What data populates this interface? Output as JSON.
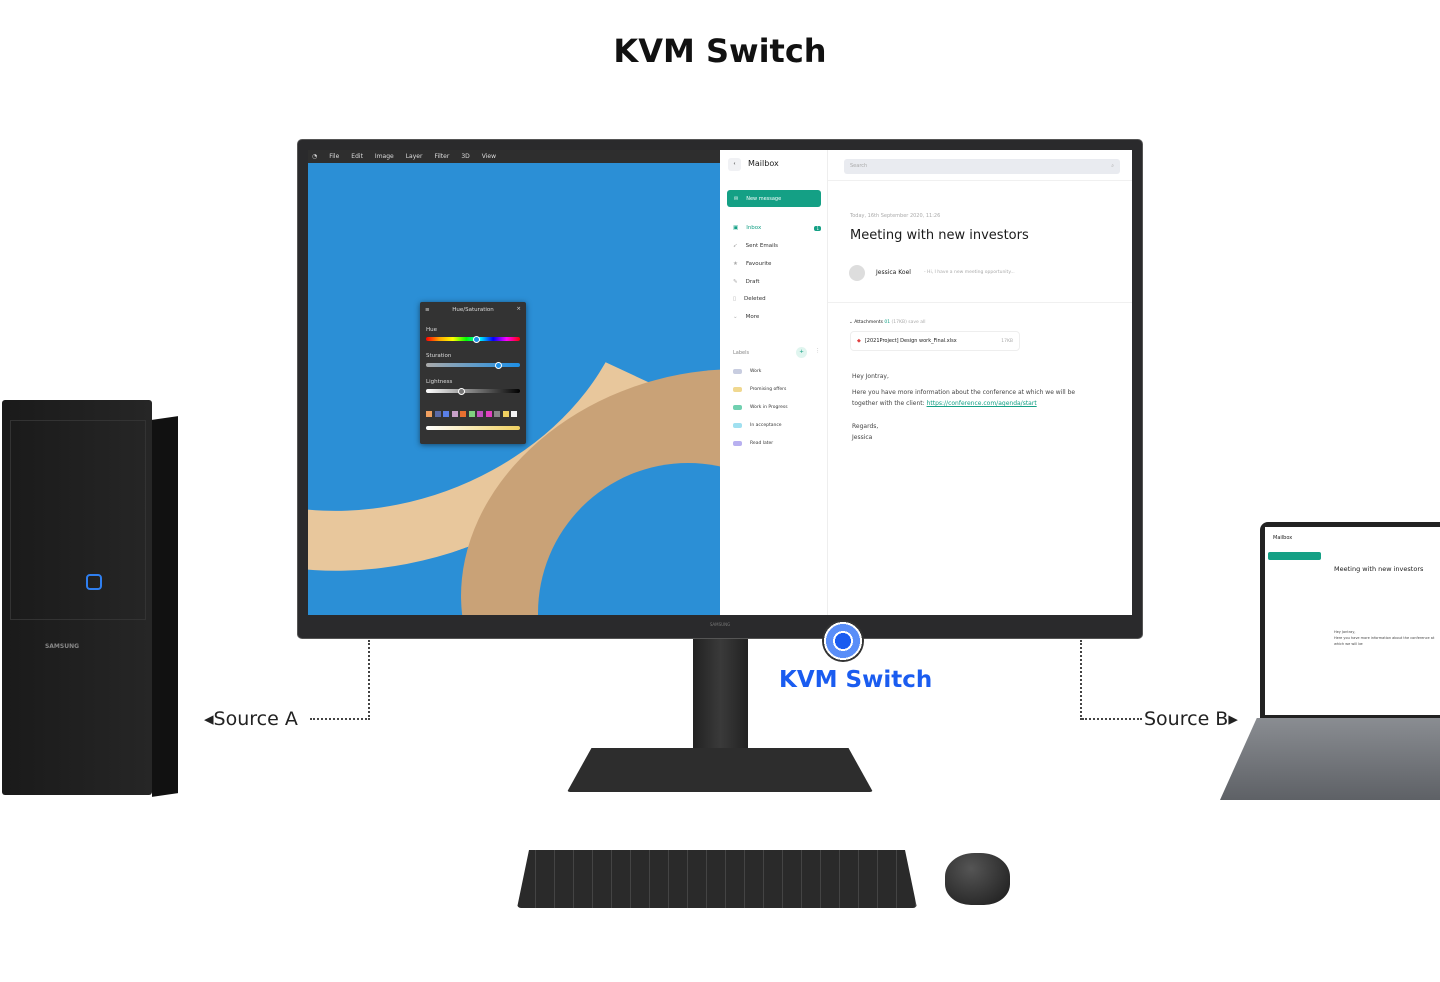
{
  "title": "KVM Switch",
  "kvm_label": "KVM Switch",
  "source_a": "Source A",
  "source_b": "Source B",
  "brand": "SAMSUNG",
  "colors": {
    "accent_blue": "#1a5cf0",
    "mail_green": "#14a085"
  },
  "editor": {
    "menu": [
      "File",
      "Edit",
      "Image",
      "Layer",
      "Filter",
      "3D",
      "View"
    ],
    "panel": {
      "title": "Hue/Saturation",
      "hue_label": "Hue",
      "saturation_label": "Sturation",
      "lightness_label": "Lightness",
      "hue_value": 0.54,
      "saturation_value": 0.77,
      "lightness_value": 0.38,
      "swatches": [
        "#f0a060",
        "#5a6aa8",
        "#5a80e8",
        "#c8a0c8",
        "#e87030",
        "#80d080",
        "#c050c0",
        "#e040c0",
        "#888888",
        "#f0d060",
        "#f4f4f4"
      ]
    }
  },
  "mail": {
    "header": "Mailbox",
    "search_placeholder": "Search",
    "new_message": "New message",
    "nav": [
      {
        "label": "Inbox",
        "icon": "inbox-icon",
        "badge": "1"
      },
      {
        "label": "Sent Emails",
        "icon": "send-icon"
      },
      {
        "label": "Favourite",
        "icon": "star-icon"
      },
      {
        "label": "Draft",
        "icon": "pencil-icon"
      },
      {
        "label": "Deleted",
        "icon": "trash-icon"
      },
      {
        "label": "More",
        "icon": "chevron-down-icon"
      }
    ],
    "labels_title": "Labels",
    "labels": [
      {
        "label": "Work",
        "color": "#c8cde0"
      },
      {
        "label": "Promising offers",
        "color": "#f0d890"
      },
      {
        "label": "Work in Progress",
        "color": "#70d0b0"
      },
      {
        "label": "In acceptance",
        "color": "#a0e0f0"
      },
      {
        "label": "Read later",
        "color": "#b8b0f0"
      }
    ],
    "date": "Today, 16th September 2020, 11:26",
    "subject": "Meeting with new investors",
    "sender": "Jessica Koel",
    "preview": "- Hi, I have a new meeting opportunity...",
    "attachments_label": "Attachments",
    "attachments_count": "01",
    "attachments_size": "(17KB)",
    "save_all": "save all",
    "file_name": "[2021Project] Design work_Final.xlsx",
    "file_size": "17KB",
    "greeting": "Hey Jontray,",
    "body1": "Here you have more information about the conference at which we will be",
    "body2": "together with the client:",
    "link": "https://conference.com/agenda/start",
    "regards": "Regards,",
    "signature": "Jessica"
  }
}
